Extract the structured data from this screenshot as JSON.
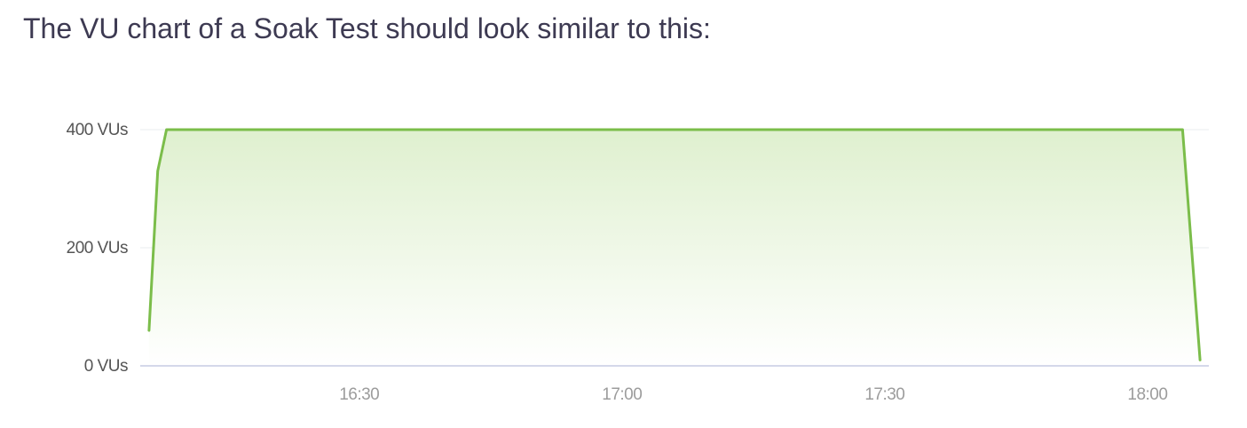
{
  "intro_text": "The VU chart of a Soak Test should look similar to this:",
  "colors": {
    "line": "#7bbd4a",
    "fill_top": "#dff0cf",
    "fill_bottom": "#ffffff",
    "grid": "#e9ecef",
    "baseline": "#c5cbe3",
    "y_tick": "#555555",
    "x_tick": "#9c9c9c",
    "text": "#3d3a52"
  },
  "chart_data": {
    "type": "area",
    "title": "",
    "xlabel": "",
    "ylabel": "",
    "y_ticks": [
      {
        "value": 0,
        "label": "0 VUs"
      },
      {
        "value": 200,
        "label": "200 VUs"
      },
      {
        "value": 400,
        "label": "400 VUs"
      }
    ],
    "x_ticks": [
      {
        "value": "16:30",
        "label": "16:30"
      },
      {
        "value": "17:00",
        "label": "17:00"
      },
      {
        "value": "17:30",
        "label": "17:30"
      },
      {
        "value": "18:00",
        "label": "18:00"
      }
    ],
    "xlim": [
      "16:05",
      "18:07"
    ],
    "ylim": [
      0,
      400
    ],
    "grid": true,
    "series": [
      {
        "x": [
          "16:06",
          "16:07",
          "16:08",
          "18:04",
          "18:06"
        ],
        "y": [
          60,
          330,
          400,
          400,
          10
        ]
      }
    ]
  }
}
